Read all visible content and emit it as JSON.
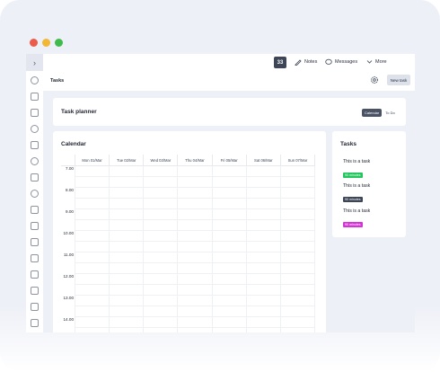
{
  "window": {
    "controls": [
      "close",
      "minimize",
      "maximize"
    ]
  },
  "sidebar": {
    "toggle_icon": "chevron-right-icon",
    "icons": [
      "people-icon",
      "folder-icon",
      "building-icon",
      "user-group-icon",
      "tag-icon",
      "clock-icon",
      "camera-icon",
      "attachment-icon",
      "inbox-icon",
      "chart-icon",
      "calendar-icon",
      "car-icon",
      "book-icon",
      "lock-icon",
      "mobile-icon",
      "document-icon"
    ]
  },
  "topbar": {
    "badge_count": "33",
    "notes_label": "Notes",
    "messages_label": "Messages",
    "more_label": "More"
  },
  "header": {
    "title": "Tasks",
    "new_task_label": "New task"
  },
  "planner": {
    "title": "Task planner",
    "views": [
      "Calendar",
      "To Do"
    ],
    "active_view": "Calendar"
  },
  "calendar": {
    "title": "Calendar",
    "days": [
      "Mon 01/Mar",
      "Tue 02/Mar",
      "Wed 03/Mar",
      "Thu 04/Mar",
      "Fri 05/Mar",
      "Sat 06/Mar",
      "Sun 07/Mar"
    ],
    "times": [
      "7.00",
      "8.00",
      "9.00",
      "10.00",
      "11.00",
      "12.00",
      "13.00",
      "14.00"
    ]
  },
  "tasks_panel": {
    "title": "Tasks",
    "items": [
      {
        "name": "This is a task",
        "duration": "90 minutes",
        "color": "#22c55e"
      },
      {
        "name": "This is a task",
        "duration": "90 minutes",
        "color": "#3c4656"
      },
      {
        "name": "This is a task",
        "duration": "90 minutes",
        "color": "#d633d6"
      }
    ]
  },
  "colors": {
    "accent_dark": "#3c4656",
    "background": "#eef0f7"
  }
}
